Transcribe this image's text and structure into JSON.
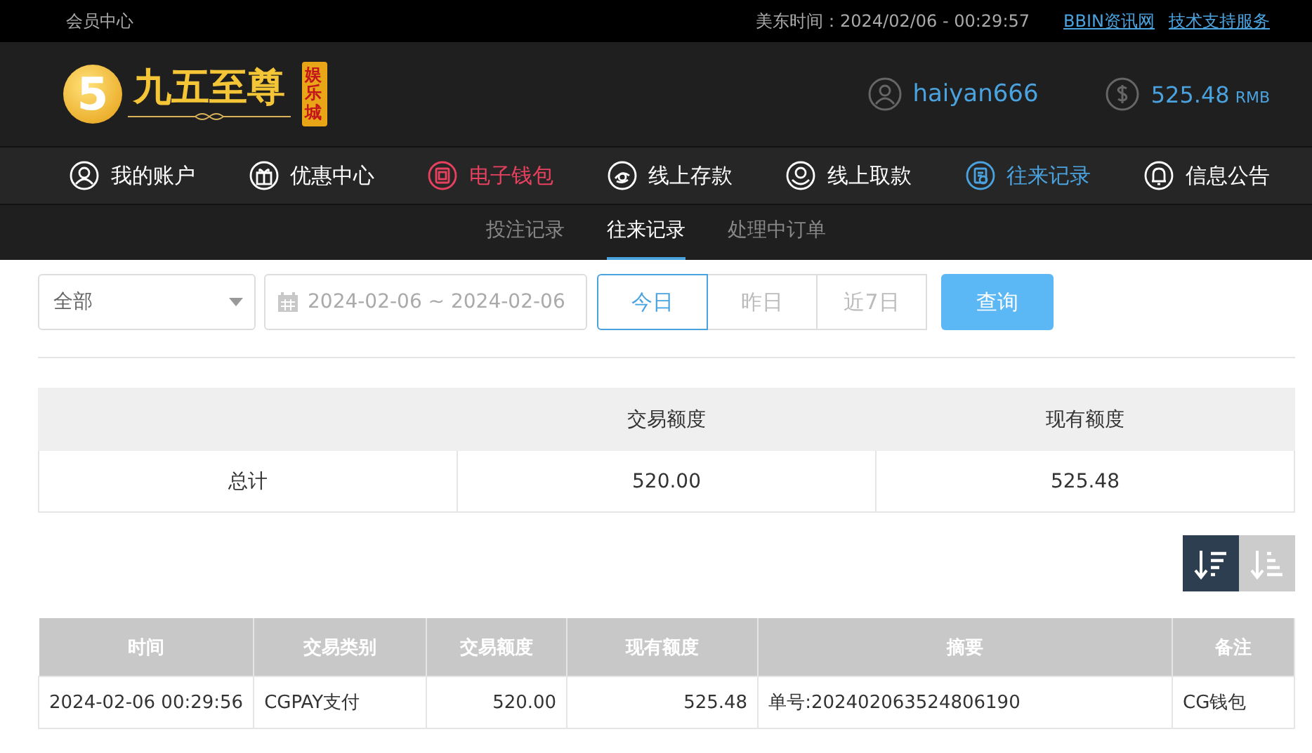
{
  "top_bar": {
    "title": "会员中心",
    "clock": "美东时间：2024/02/06 - 00:29:57",
    "links": [
      "BBIN资讯网",
      "技术支持服务"
    ]
  },
  "header": {
    "logo": {
      "mark": "5",
      "name": "九五至尊",
      "badge": "娱乐城"
    },
    "username": "haiyan666",
    "balance": "525.48",
    "currency": "RMB"
  },
  "nav": [
    {
      "label": "我的账户",
      "color": "#ffffff"
    },
    {
      "label": "优惠中心",
      "color": "#ffffff"
    },
    {
      "label": "电子钱包",
      "color": "#e8415f"
    },
    {
      "label": "线上存款",
      "color": "#ffffff"
    },
    {
      "label": "线上取款",
      "color": "#ffffff"
    },
    {
      "label": "往来记录",
      "color": "#4aa3df"
    },
    {
      "label": "信息公告",
      "color": "#ffffff"
    }
  ],
  "sub_nav": [
    {
      "label": "投注记录",
      "selected": false
    },
    {
      "label": "往来记录",
      "selected": true
    },
    {
      "label": "处理中订单",
      "selected": false
    }
  ],
  "filter": {
    "type_select": "全部",
    "date_range": "2024-02-06 ~ 2024-02-06",
    "ranges": [
      {
        "label": "今日",
        "selected": true
      },
      {
        "label": "昨日",
        "selected": false
      },
      {
        "label": "近7日",
        "selected": false
      }
    ],
    "search_button": "查询"
  },
  "summary": {
    "columns": [
      "",
      "交易额度",
      "现有额度"
    ],
    "rows": [
      [
        "总计",
        "520.00",
        "525.48"
      ]
    ]
  },
  "sort_buttons": [
    {
      "kind": "desc",
      "selected": true
    },
    {
      "kind": "asc",
      "selected": false
    }
  ],
  "table": {
    "columns": [
      "时间",
      "交易类别",
      "交易额度",
      "现有额度",
      "摘要",
      "备注"
    ],
    "rows": [
      [
        "2024-02-06 00:29:56",
        "CGPAY支付",
        "520.00",
        "525.48",
        "单号:202402063524806190",
        "CG钱包"
      ]
    ]
  }
}
